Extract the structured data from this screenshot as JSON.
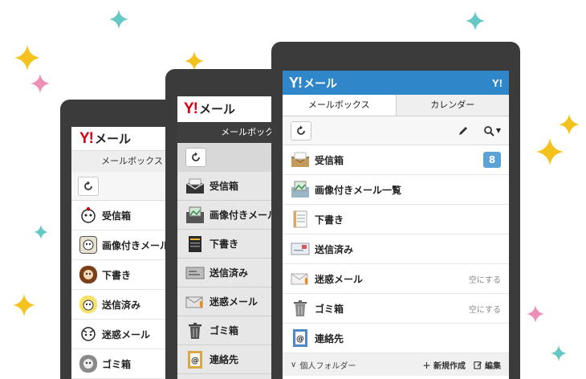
{
  "brand": {
    "y": "Y!",
    "mail": "メール",
    "mini_logo": "Y!"
  },
  "colors": {
    "header_blue": "#2f86c8",
    "badge": "#5ba3d4",
    "brand_red": "#d90012",
    "phone_frame": "#3b3b3b",
    "sparkle_gold": "#f4c21c",
    "sparkle_teal": "#66c8c4",
    "sparkle_pink": "#ef8fb8"
  },
  "phone_left": {
    "tab": "メールボックス",
    "refresh_icon": "refresh-icon",
    "folders": [
      {
        "label": "受信箱",
        "icon": "inbox-character-icon"
      },
      {
        "label": "画像付きメール",
        "icon": "photo-character-icon"
      },
      {
        "label": "下書き",
        "icon": "draft-character-icon"
      },
      {
        "label": "送信済み",
        "icon": "sent-character-icon"
      },
      {
        "label": "迷惑メール",
        "icon": "spam-character-icon"
      },
      {
        "label": "ゴミ箱",
        "icon": "trash-character-icon"
      }
    ]
  },
  "phone_middle": {
    "tab": "メールボックス",
    "refresh_icon": "refresh-icon",
    "folders": [
      {
        "label": "受信箱",
        "icon": "inbox-icon"
      },
      {
        "label": "画像付きメール",
        "icon": "photo-mail-icon"
      },
      {
        "label": "下書き",
        "icon": "notebook-icon"
      },
      {
        "label": "送信済み",
        "icon": "sent-icon"
      },
      {
        "label": "迷惑メール",
        "icon": "spam-icon"
      },
      {
        "label": "ゴミ箱",
        "icon": "trash-icon"
      },
      {
        "label": "連絡先",
        "icon": "contacts-icon"
      }
    ]
  },
  "phone_right": {
    "tabs": [
      "メールボックス",
      "カレンダー"
    ],
    "toolbar": {
      "refresh_icon": "refresh-icon",
      "compose_icon": "pencil-icon",
      "search_icon": "search-icon",
      "dropdown": "▼"
    },
    "folders": [
      {
        "label": "受信箱",
        "icon": "inbox-icon",
        "badge": "8",
        "action": ""
      },
      {
        "label": "画像付きメール一覧",
        "icon": "photo-mail-icon",
        "badge": "",
        "action": ""
      },
      {
        "label": "下書き",
        "icon": "notebook-icon",
        "badge": "",
        "action": ""
      },
      {
        "label": "送信済み",
        "icon": "sent-icon",
        "badge": "",
        "action": ""
      },
      {
        "label": "迷惑メール",
        "icon": "spam-icon",
        "badge": "",
        "action": "空にする"
      },
      {
        "label": "ゴミ箱",
        "icon": "trash-icon",
        "badge": "",
        "action": "空にする"
      },
      {
        "label": "連絡先",
        "icon": "contacts-icon",
        "badge": "",
        "action": ""
      }
    ],
    "personal_folder": {
      "chevron": "∨",
      "title": "個人フォルダー",
      "new_label": "＋ 新規作成",
      "edit_label": "編集"
    }
  }
}
